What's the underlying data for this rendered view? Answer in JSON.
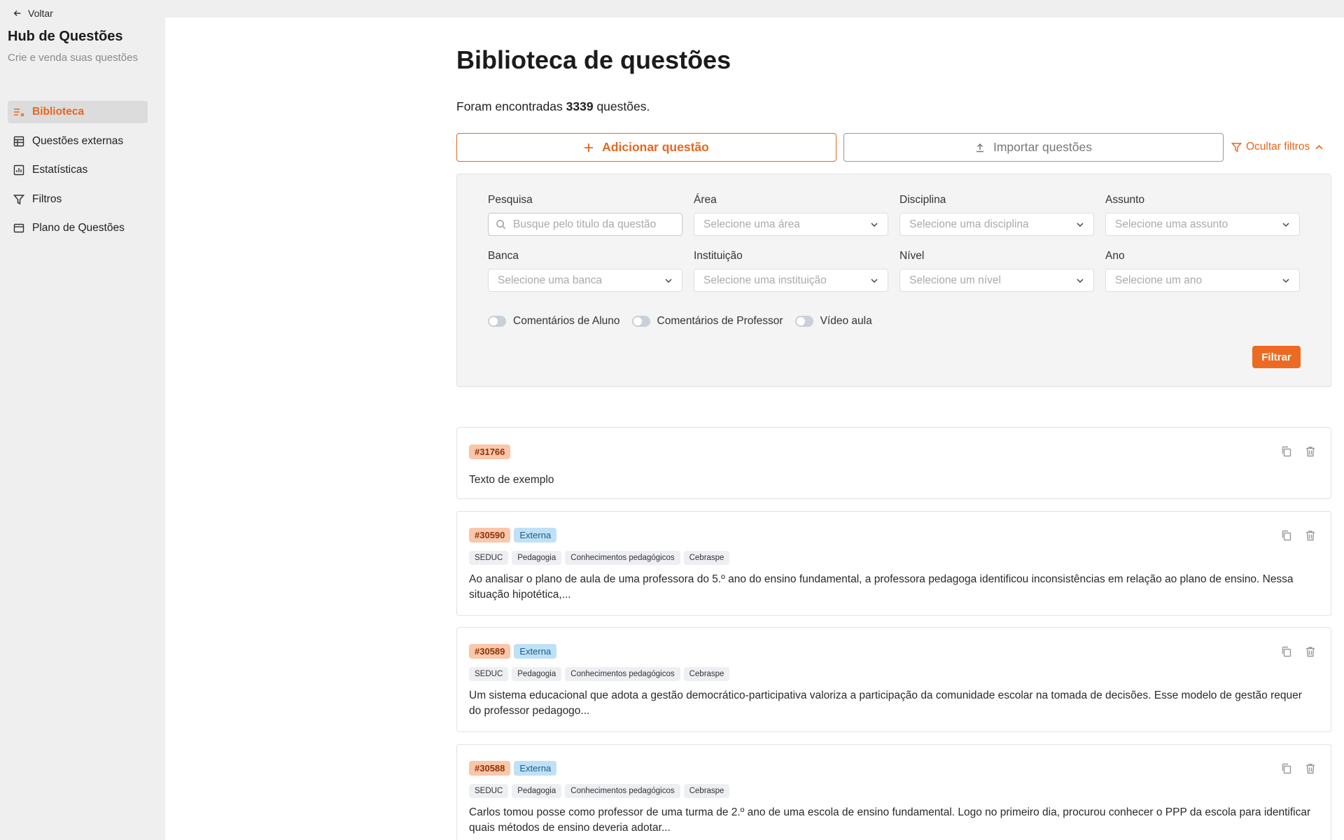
{
  "sidebar": {
    "back_label": "Voltar",
    "title": "Hub de Questões",
    "subtitle": "Crie e venda suas questões",
    "items": [
      {
        "label": "Biblioteca",
        "icon": "list-check-icon",
        "active": true
      },
      {
        "label": "Questões externas",
        "icon": "table-icon",
        "active": false
      },
      {
        "label": "Estatísticas",
        "icon": "bar-chart-icon",
        "active": false
      },
      {
        "label": "Filtros",
        "icon": "filter-icon",
        "active": false
      },
      {
        "label": "Plano de Questões",
        "icon": "card-icon",
        "active": false
      }
    ]
  },
  "main": {
    "title": "Biblioteca de questões",
    "count_prefix": "Foram encontradas",
    "count_value": "3339",
    "count_suffix": "questões.",
    "add_button": "Adicionar questão",
    "import_button": "Importar questões",
    "toggle_filters": "Ocultar filtros"
  },
  "filters": {
    "search": {
      "label": "Pesquisa",
      "placeholder": "Busque pelo titulo da questão"
    },
    "area": {
      "label": "Área",
      "placeholder": "Selecione uma área"
    },
    "disciplina": {
      "label": "Disciplina",
      "placeholder": "Selecione uma disciplina"
    },
    "assunto": {
      "label": "Assunto",
      "placeholder": "Selecione uma assunto"
    },
    "banca": {
      "label": "Banca",
      "placeholder": "Selecione uma banca"
    },
    "instituicao": {
      "label": "Instituição",
      "placeholder": "Selecione uma instituição"
    },
    "nivel": {
      "label": "Nível",
      "placeholder": "Selecione um nível"
    },
    "ano": {
      "label": "Ano",
      "placeholder": "Selecione um ano"
    },
    "toggles": [
      "Comentários de Aluno",
      "Comentários de Professor",
      "Vídeo aula"
    ],
    "filter_button": "Filtrar"
  },
  "questions": [
    {
      "id": "#31766",
      "badge": "",
      "tags": [],
      "text": "Texto de exemplo"
    },
    {
      "id": "#30590",
      "badge": "Externa",
      "tags": [
        "SEDUC",
        "Pedagogia",
        "Conhecimentos pedagógicos",
        "Cebraspe"
      ],
      "text": "Ao analisar o plano de aula de uma professora do 5.º ano do ensino fundamental, a professora pedagoga identificou inconsistências em relação ao plano de ensino. Nessa situação hipotética,..."
    },
    {
      "id": "#30589",
      "badge": "Externa",
      "tags": [
        "SEDUC",
        "Pedagogia",
        "Conhecimentos pedagógicos",
        "Cebraspe"
      ],
      "text": "Um sistema educacional que adota a gestão democrático-participativa valoriza a participação da comunidade escolar na tomada de decisões. Esse modelo de gestão requer do professor pedagogo..."
    },
    {
      "id": "#30588",
      "badge": "Externa",
      "tags": [
        "SEDUC",
        "Pedagogia",
        "Conhecimentos pedagógicos",
        "Cebraspe"
      ],
      "text": "Carlos tomou posse como professor de uma turma de 2.º ano de uma escola de ensino fundamental. Logo no primeiro dia, procurou conhecer o PPP da escola para identificar quais métodos de ensino deveria adotar..."
    }
  ],
  "colors": {
    "accent": "#e8661e",
    "id_badge": "#fbc6a9",
    "external_badge": "#bfe1f7"
  }
}
